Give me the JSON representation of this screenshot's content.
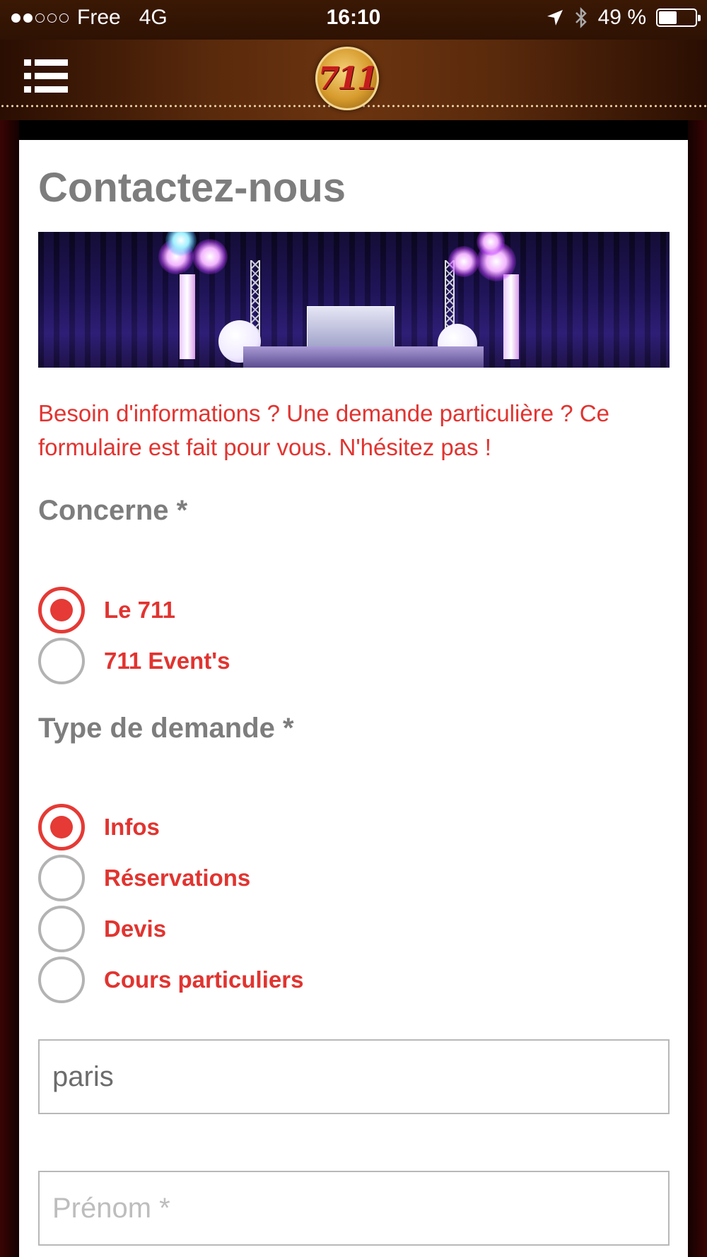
{
  "status_bar": {
    "carrier": "Free",
    "network": "4G",
    "time": "16:10",
    "battery_percent_text": "49 %",
    "battery_level": 0.49,
    "signal_bars_filled": 2,
    "signal_bars_total": 5,
    "icons": [
      "location-arrow-icon",
      "bluetooth-icon",
      "battery-icon"
    ]
  },
  "header": {
    "logo_text": "711",
    "menu_icon": "hamburger-menu-icon"
  },
  "form": {
    "title": "Contactez-nous",
    "intro": "Besoin d'informations ? Une demande particulière ? Ce formulaire est fait pour vous. N'hésitez pas !",
    "concerne": {
      "label": "Concerne *",
      "options": [
        {
          "label": "Le 711",
          "checked": true
        },
        {
          "label": "711 Event's",
          "checked": false
        }
      ]
    },
    "type_demande": {
      "label": "Type de demande *",
      "options": [
        {
          "label": "Infos",
          "checked": true
        },
        {
          "label": "Réservations",
          "checked": false
        },
        {
          "label": "Devis",
          "checked": false
        },
        {
          "label": "Cours particuliers",
          "checked": false
        }
      ]
    },
    "nom": {
      "value": "paris",
      "placeholder": ""
    },
    "prenom": {
      "value": "",
      "placeholder": "Prénom *"
    }
  },
  "colors": {
    "accent": "#e13430",
    "label_grey": "#7d7d7d",
    "header_brown": "#5a2a0c"
  }
}
